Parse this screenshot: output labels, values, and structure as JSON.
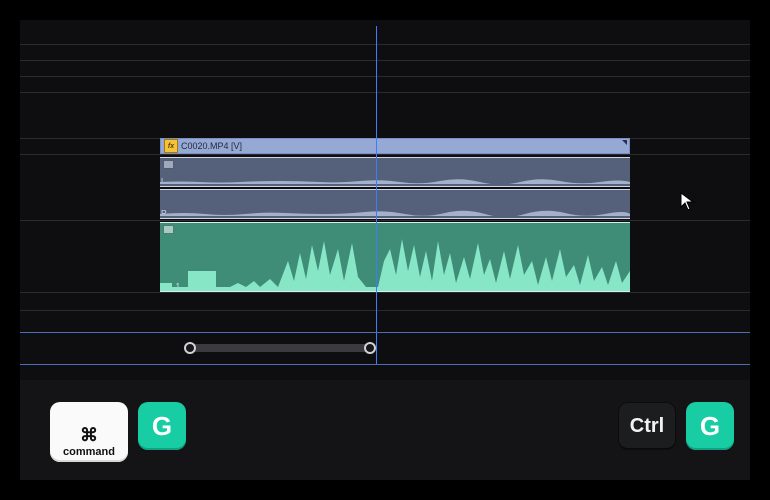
{
  "clip": {
    "video_label": "C0020.MP4 [V]",
    "fx_badge": "fx",
    "stereo_left_label": "L",
    "stereo_right_label": "R",
    "mono_channel_label": "Ch. 1"
  },
  "shortcuts": {
    "mac": {
      "symbol": "⌘",
      "mod_label": "command",
      "key": "G"
    },
    "win": {
      "mod_label": "Ctrl",
      "key": "G"
    }
  },
  "colors": {
    "accent_green": "#18cda3",
    "video_clip": "#96a9d4",
    "audio_green": "#3f8c77",
    "playhead": "#3d7bff"
  }
}
